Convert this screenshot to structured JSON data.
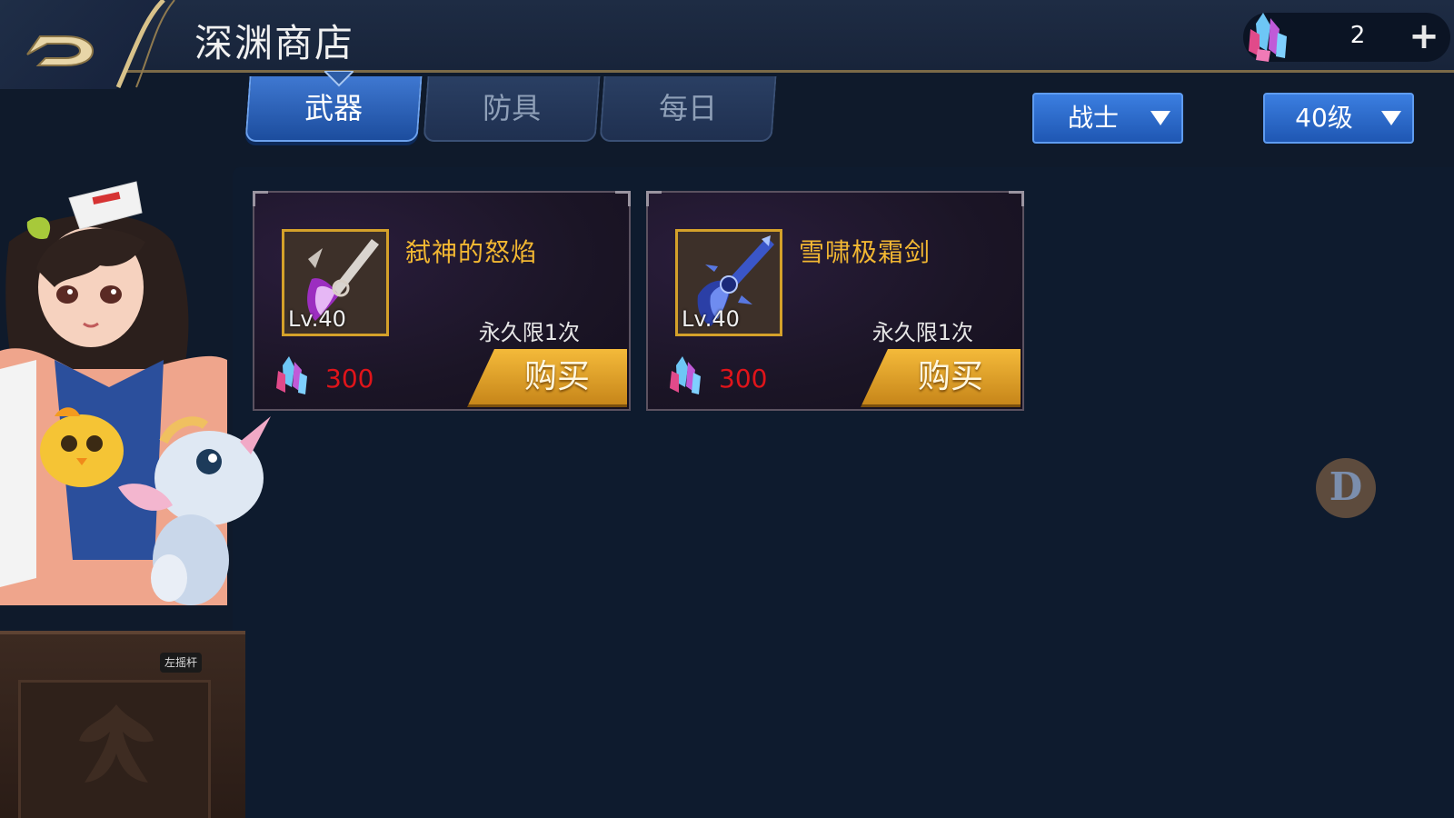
{
  "header": {
    "title": "深渊商店",
    "currency_value": "2",
    "plus_label": "+"
  },
  "tabs": [
    {
      "label": "武器",
      "active": true
    },
    {
      "label": "防具",
      "active": false
    },
    {
      "label": "每日",
      "active": false
    }
  ],
  "filters": {
    "class_label": "战士",
    "level_label": "40级"
  },
  "items": [
    {
      "name": "弑神的怒焰",
      "level": "Lv.40",
      "limit": "永久限1次",
      "price": "300",
      "buy_label": "购买"
    },
    {
      "name": "雪啸极霜剑",
      "level": "Lv.40",
      "limit": "永久限1次",
      "price": "300",
      "buy_label": "购买"
    }
  ],
  "joystick_label": "左摇杆",
  "float_button_label": "D",
  "colors": {
    "accent_blue": "#3b7ee0",
    "item_name": "#f2b732",
    "price": "#e0141a",
    "buy_gold": "#f4ba3a"
  }
}
